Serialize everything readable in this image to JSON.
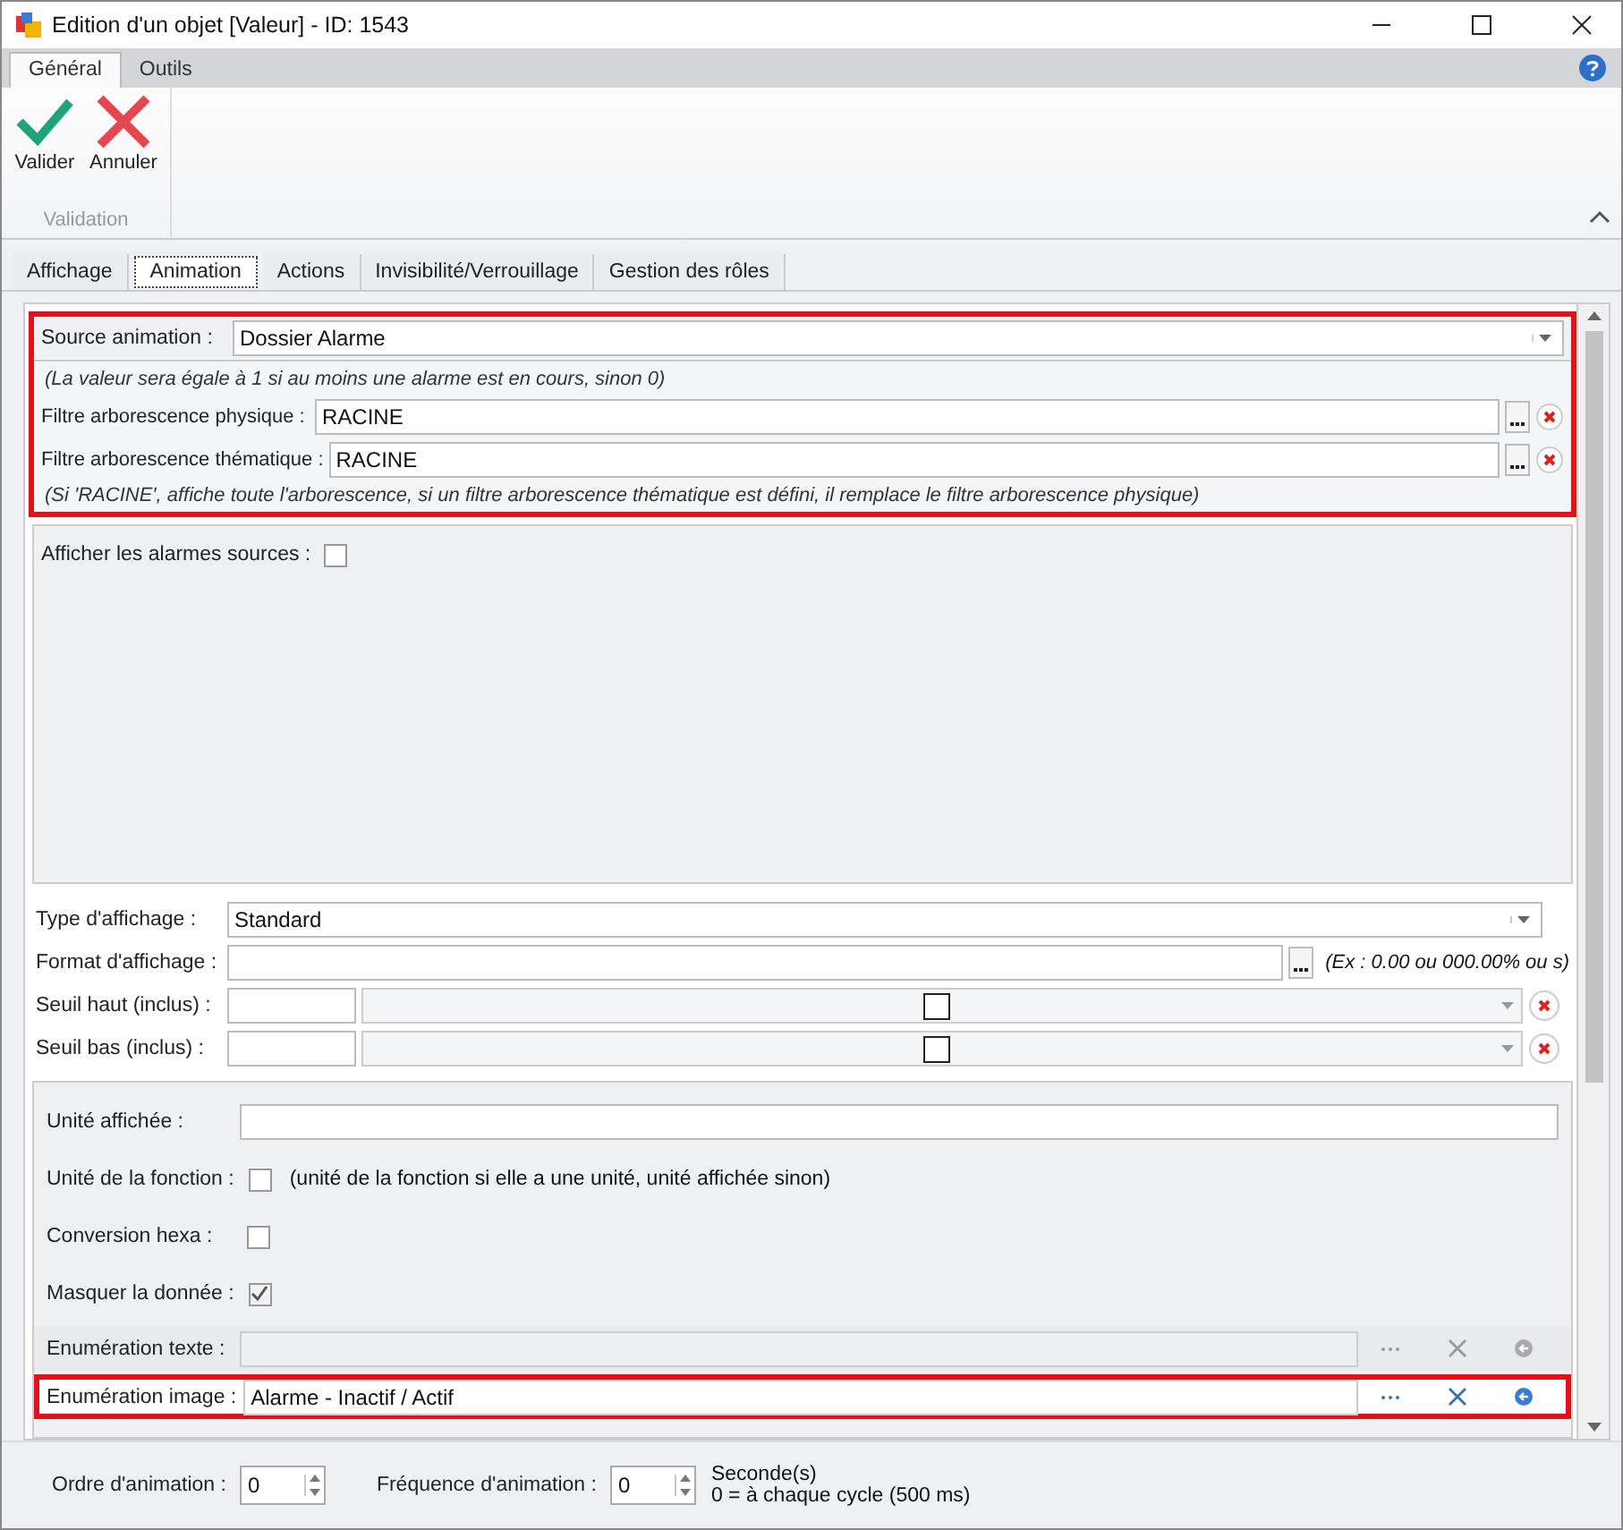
{
  "window": {
    "title": "Edition d'un objet [Valeur] - ID: 1543"
  },
  "ribbon": {
    "tabs": [
      {
        "label": "Général",
        "selected": true
      },
      {
        "label": "Outils",
        "selected": false
      }
    ],
    "buttons": [
      {
        "label": "Valider",
        "kind": "confirm"
      },
      {
        "label": "Annuler",
        "kind": "cancel"
      }
    ],
    "group_label": "Validation"
  },
  "tabs": [
    {
      "label": "Affichage",
      "selected": false
    },
    {
      "label": "Animation",
      "selected": true
    },
    {
      "label": "Actions",
      "selected": false
    },
    {
      "label": "Invisibilité/Verrouillage",
      "selected": false
    },
    {
      "label": "Gestion des rôles",
      "selected": false
    }
  ],
  "source": {
    "highlighted": true,
    "label": "Source animation :",
    "value": "Dossier Alarme",
    "note": "(La valeur sera égale à 1 si au moins une alarme est en cours, sinon 0)",
    "filters": [
      {
        "label": "Filtre arborescence physique :",
        "value": "RACINE"
      },
      {
        "label": "Filtre arborescence thématique :",
        "value": "RACINE"
      }
    ],
    "footnote": "(Si 'RACINE', affiche toute l'arborescence, si un filtre arborescence thématique est défini, il remplace le filtre arborescence physique)"
  },
  "show_sources": {
    "label": "Afficher les alarmes sources :",
    "checked": false
  },
  "display": [
    {
      "kind": "combo",
      "label": "Type d'affichage :",
      "value": "Standard"
    },
    {
      "kind": "format",
      "label": "Format d'affichage :",
      "hint": "(Ex : 0.00 ou 000.00% ou s)"
    },
    {
      "kind": "threshold",
      "label": "Seuil haut (inclus) :"
    },
    {
      "kind": "threshold",
      "label": "Seuil bas (inclus) :"
    }
  ],
  "options": [
    {
      "kind": "text",
      "label": "Unité affichée :"
    },
    {
      "kind": "checkbox",
      "label": "Unité de la fonction :",
      "checked": false,
      "hint": "(unité de la fonction si elle a une unité, unité affichée sinon)"
    },
    {
      "kind": "checkbox",
      "label": "Conversion hexa :",
      "checked": false
    },
    {
      "kind": "checkbox",
      "label": "Masquer la donnée :",
      "checked": true
    },
    {
      "kind": "enum",
      "label": "Enumération texte :",
      "disabled": true,
      "highlighted": false
    },
    {
      "kind": "enum",
      "label": "Enumération image :",
      "value": "Alarme - Inactif / Actif",
      "disabled": false,
      "highlighted": true
    }
  ],
  "footer": {
    "order": {
      "label": "Ordre d'animation :",
      "value": "0"
    },
    "frequency": {
      "label": "Fréquence d'animation :",
      "value": "0",
      "unit": "Seconde(s)",
      "note": "0 = à chaque cycle (500 ms)"
    }
  }
}
